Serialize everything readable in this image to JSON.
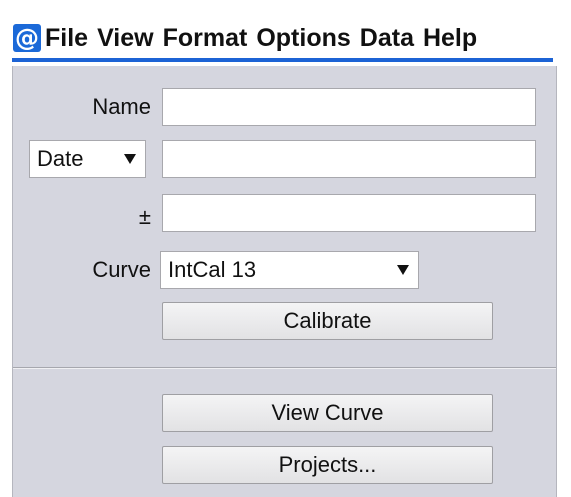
{
  "app": {
    "logo_glyph": "@",
    "accent_color": "#1c63d5",
    "panel_color": "#d5d6df"
  },
  "menubar": {
    "items": [
      "File",
      "View",
      "Format",
      "Options",
      "Data",
      "Help"
    ]
  },
  "form": {
    "name_label": "Name",
    "name_value": "",
    "date_select_value": "Date",
    "date_value": "",
    "error_label": "±",
    "error_value": "",
    "curve_label": "Curve",
    "curve_select_value": "IntCal 13",
    "calibrate_label": "Calibrate"
  },
  "actions": {
    "view_curve_label": "View Curve",
    "projects_label": "Projects..."
  }
}
